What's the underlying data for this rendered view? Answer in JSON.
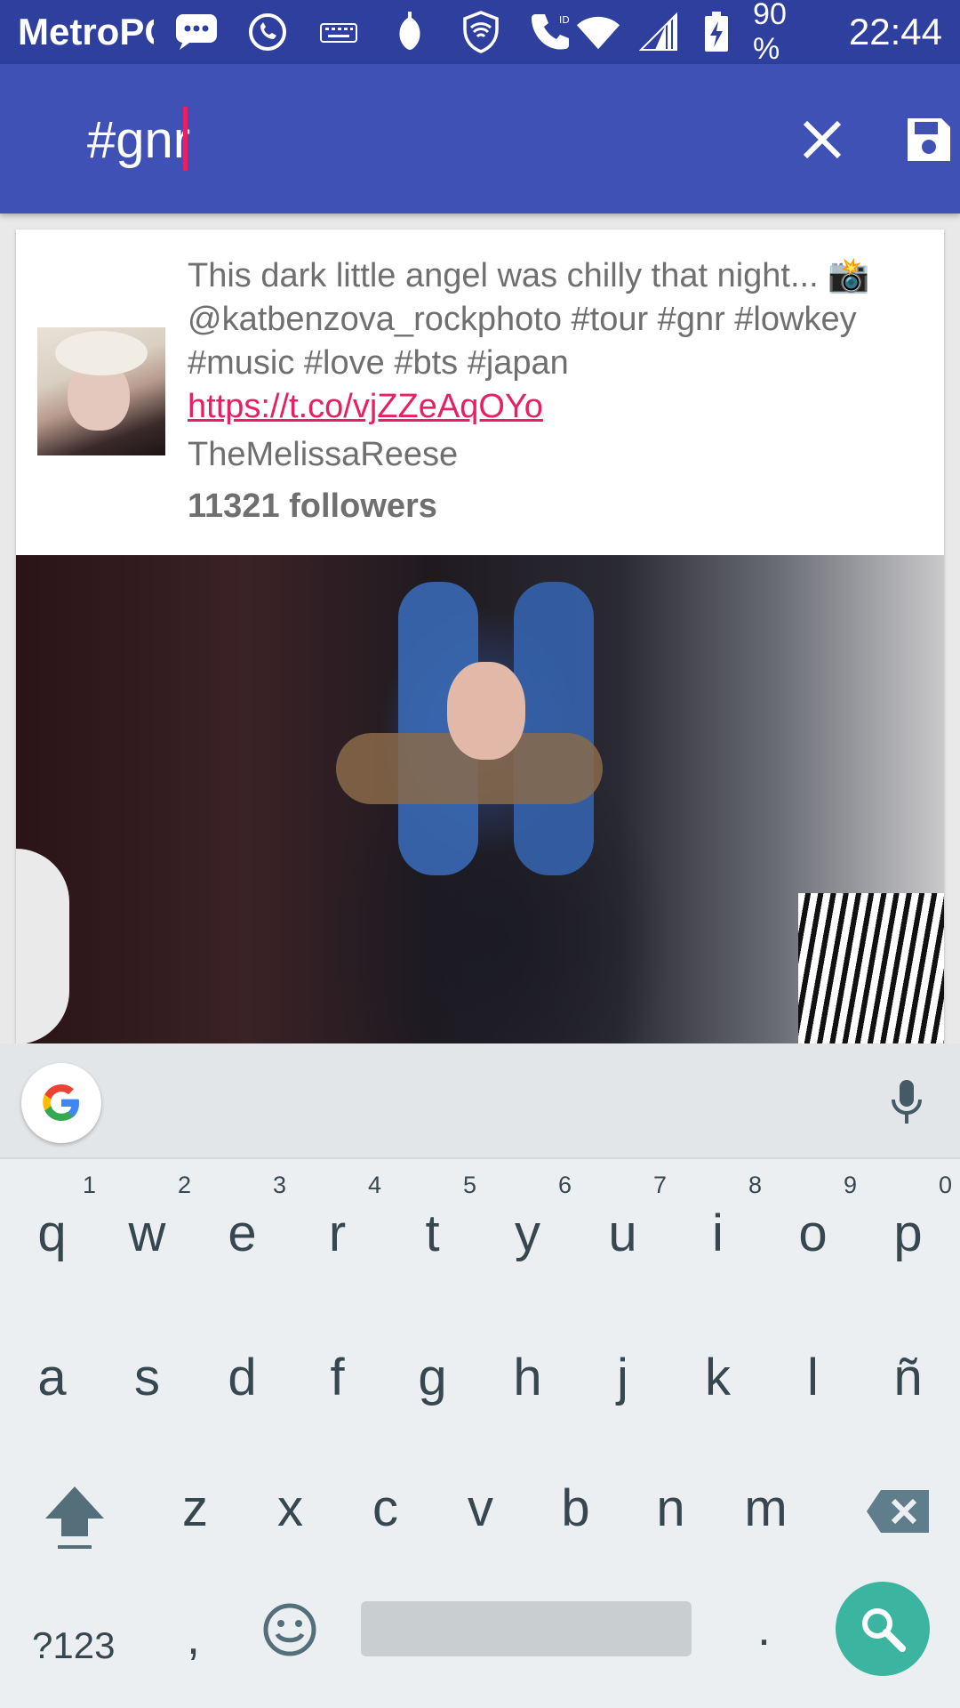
{
  "status_bar": {
    "carrier": "MetroPCS",
    "battery_pct": "90 %",
    "time": "22:44",
    "icons": [
      "chat-bubble-icon",
      "whatsapp-icon",
      "keyboard-icon",
      "notification-icon",
      "vpn-shield-icon",
      "phone-call-id-icon",
      "wifi-icon",
      "signal-icon",
      "battery-charging-icon"
    ]
  },
  "toolbar": {
    "query": "#gnr",
    "clear_icon": "close-icon",
    "save_icon": "save-icon",
    "accent": "#3f51b5",
    "cursor_color": "#e91e63"
  },
  "tweet": {
    "text_before": "This dark little angel was chilly that night... 📸@katbenzova_rockphoto #tour #gnr #lowkey #music #love #bts #japan ",
    "link": "https://t.co/vjZZeAqOYo",
    "user": "TheMelissaReese",
    "followers": "11321 followers",
    "link_color": "#e91e63"
  },
  "keyboard": {
    "row1": [
      {
        "ch": "q",
        "num": "1"
      },
      {
        "ch": "w",
        "num": "2"
      },
      {
        "ch": "e",
        "num": "3"
      },
      {
        "ch": "r",
        "num": "4"
      },
      {
        "ch": "t",
        "num": "5"
      },
      {
        "ch": "y",
        "num": "6"
      },
      {
        "ch": "u",
        "num": "7"
      },
      {
        "ch": "i",
        "num": "8"
      },
      {
        "ch": "o",
        "num": "9"
      },
      {
        "ch": "p",
        "num": "0"
      }
    ],
    "row2": [
      "a",
      "s",
      "d",
      "f",
      "g",
      "h",
      "j",
      "k",
      "l",
      "ñ"
    ],
    "row3": [
      "z",
      "x",
      "c",
      "v",
      "b",
      "n",
      "m"
    ],
    "sym": "?123",
    "comma": ",",
    "period": ".",
    "search_color": "#3cb5a0"
  }
}
